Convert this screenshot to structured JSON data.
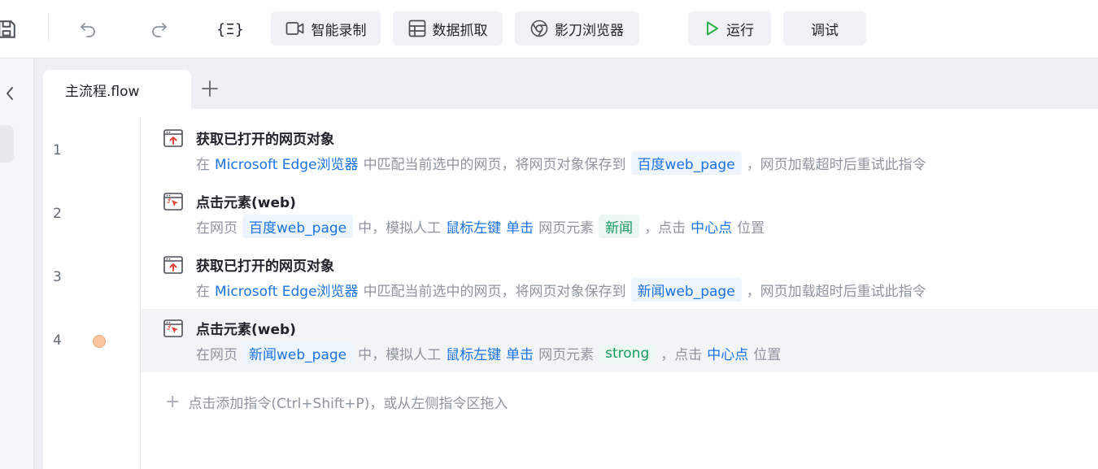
{
  "toolbar": {
    "icons": [
      "save-icon",
      "undo-icon",
      "redo-icon",
      "variable-braces-icon"
    ],
    "variable_label": "{Ξ}",
    "smart_record_label": "智能录制",
    "data_scrape_label": "数据抓取",
    "browser_label": "影刀浏览器",
    "run_label": "运行",
    "debug_label": "调试"
  },
  "tabs": [
    {
      "label": "主流程.flow"
    }
  ],
  "rows": [
    {
      "line": "1",
      "title": "获取已打开的网页对象",
      "desc": {
        "p1": "在",
        "browser": "Microsoft Edge浏览器",
        "p2": "中匹配当前选中的网页，将网页对象保存到",
        "var": "百度web_page",
        "p3": "，网页加载超时后重试此指令"
      }
    },
    {
      "line": "2",
      "title": "点击元素(web)",
      "desc": {
        "p1": "在网页",
        "var": "百度web_page",
        "p2": "中，模拟人工",
        "button": "鼠标左键",
        "click": "单击",
        "p3": "网页元素",
        "element": "新闻",
        "p4": "，点击",
        "position": "中心点",
        "p5": "位置"
      }
    },
    {
      "line": "3",
      "title": "获取已打开的网页对象",
      "desc": {
        "p1": "在",
        "browser": "Microsoft Edge浏览器",
        "p2": "中匹配当前选中的网页，将网页对象保存到",
        "var": "新闻web_page",
        "p3": "，网页加载超时后重试此指令"
      }
    },
    {
      "line": "4",
      "breakpoint": true,
      "title": "点击元素(web)",
      "desc": {
        "p1": "在网页",
        "var": "新闻web_page",
        "p2": "中，模拟人工",
        "button": "鼠标左键",
        "click": "单击",
        "p3": "网页元素",
        "element": "strong",
        "p4": "，点击",
        "position": "中心点",
        "p5": "位置"
      }
    }
  ],
  "add_hint": "点击添加指令(Ctrl+Shift+P)，或从左侧指令区拖入",
  "colors": {
    "accent": "#1a73e8",
    "element_green": "#159a5e",
    "breakpoint": "#f7c4a0",
    "run_green": "#2bb24c"
  }
}
